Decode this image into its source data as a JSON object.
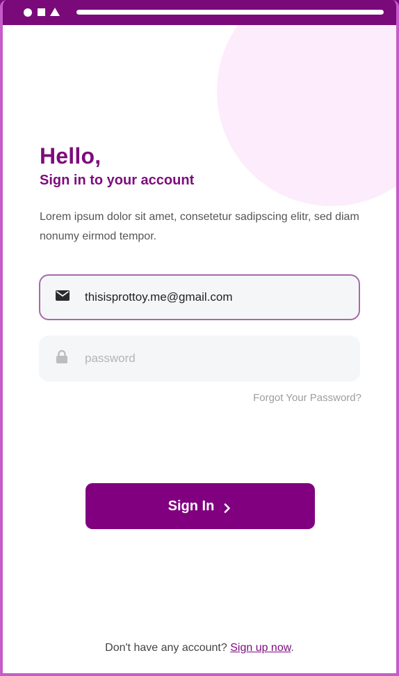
{
  "colors": {
    "brand": "#800080",
    "frame": "#7a0a7a",
    "blob": "#fcecfc",
    "field_bg": "#f5f6f8"
  },
  "status_bar": {
    "icons": [
      "circle-icon",
      "square-icon",
      "triangle-icon"
    ]
  },
  "header": {
    "title": "Hello,",
    "subtitle": "Sign in to your account"
  },
  "description": "Lorem ipsum dolor sit amet, consetetur sadipscing elitr, sed diam nonumy eirmod tempor.",
  "form": {
    "email": {
      "icon": "mail-icon",
      "value": "thisisprottoy.me@gmail.com",
      "placeholder": ""
    },
    "password": {
      "icon": "lock-icon",
      "value": "",
      "placeholder": "password"
    },
    "forgot_label": "Forgot Your Password?",
    "signin_label": "Sign In"
  },
  "footer": {
    "prompt": "Don't have any account?",
    "signup_label": "Sign up now",
    "trailing": "."
  }
}
